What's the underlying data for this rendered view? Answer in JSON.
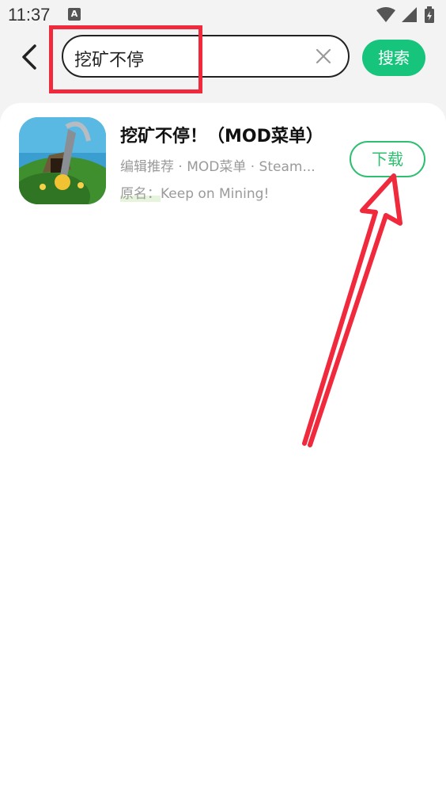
{
  "status_bar": {
    "time": "11:37",
    "notification_letter": "A"
  },
  "search": {
    "query": "挖矿不停",
    "button_label": "搜索"
  },
  "result": {
    "title": "挖矿不停！（MOD菜单）",
    "subtitle": "编辑推荐 · MOD菜单 · Steam...",
    "original_label": "原名：",
    "original_name": "Keep on Mining!",
    "download_label": "下载"
  },
  "colors": {
    "accent": "#16c47c",
    "download": "#2fbf70",
    "annotation": "#f0293c"
  }
}
